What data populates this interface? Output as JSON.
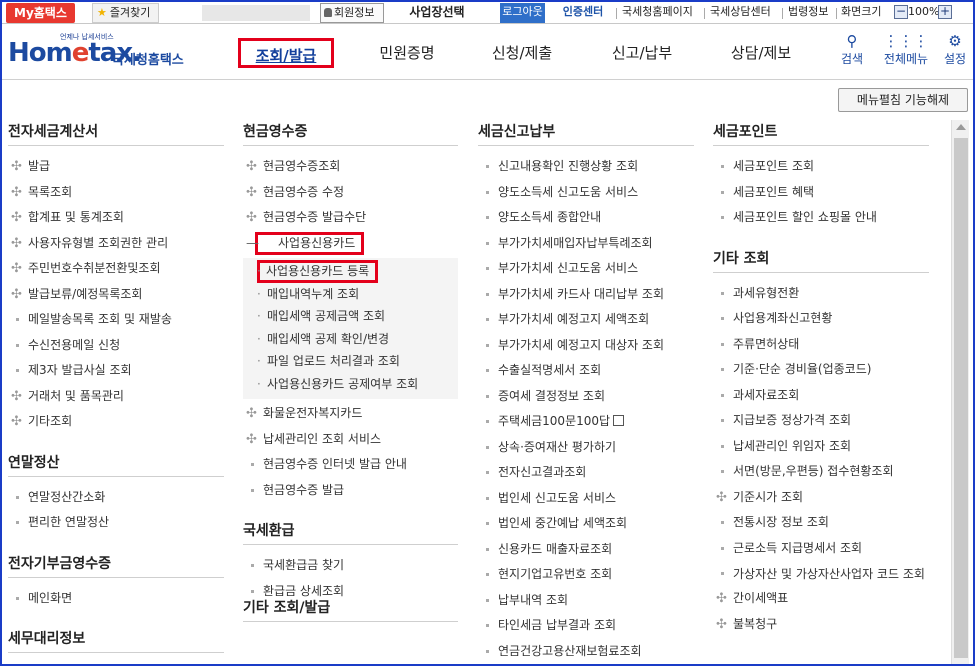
{
  "topbar": {
    "my_hometax": "My홈택스",
    "favorites": "즐겨찾기",
    "member_info": "회원정보",
    "select_business": "사업장선택",
    "logout": "로그아웃",
    "cert_center": "인증센터",
    "links": [
      "국세청홈페이지",
      "국세상담센터",
      "법령정보",
      "화면크기"
    ],
    "zoom_minus": "−",
    "zoom_value": "100%",
    "zoom_plus": "+"
  },
  "header": {
    "logo_small": "언제나 납세서비스",
    "logo_main_1": "Hom",
    "logo_main_2": "e",
    "logo_main_3": "tax.",
    "logo_kr": "국세청홈택스",
    "nav": [
      "조회/발급",
      "민원증명",
      "신청/제출",
      "신고/납부",
      "상담/제보"
    ],
    "icons": [
      {
        "label": "검색",
        "icon": "search-icon"
      },
      {
        "label": "전체메뉴",
        "icon": "grid-icon"
      },
      {
        "label": "설정",
        "icon": "gear-icon"
      }
    ]
  },
  "unfold_button": "메뉴펼침 기능해제",
  "col1": {
    "s1_title": "전자세금계산서",
    "s1_items": [
      "발급",
      "목록조회",
      "합계표 및 통계조회",
      "사용자유형별 조회권한 관리",
      "주민번호수취분전환및조회",
      "발급보류/예정목록조회",
      "메일발송목록 조회 및 재발송",
      "수신전용메일 신청",
      "제3자 발급사실 조회",
      "거래처 및 품목관리",
      "기타조회"
    ],
    "s2_title": "연말정산",
    "s2_items": [
      "연말정산간소화",
      "편리한 연말정산"
    ],
    "s3_title": "전자기부금영수증",
    "s3_items": [
      "메인화면"
    ],
    "s4_title": "세무대리정보"
  },
  "col2": {
    "s1_title": "현금영수증",
    "s1_items": [
      "현금영수증조회",
      "현금영수증 수정",
      "현금영수증 발급수단"
    ],
    "open_item": "사업용신용카드",
    "sub_items": [
      "사업용신용카드 등록",
      "매입내역누계 조회",
      "매입세액 공제금액 조회",
      "매입세액 공제 확인/변경",
      "파일 업로드 처리결과 조회",
      "사업용신용카드 공제여부 조회"
    ],
    "s1_items_after": [
      "화물운전자복지카드",
      "납세관리인 조회 서비스",
      "현금영수증 인터넷 발급 안내",
      "현금영수증 발급"
    ],
    "s2_title": "국세환급",
    "s2_items": [
      "국세환급금 찾기",
      "환급금 상세조회"
    ],
    "s3_title": "기타 조회/발급"
  },
  "col3": {
    "s1_title": "세금신고납부",
    "s1_items": [
      "신고내용확인 진행상황 조회",
      "양도소득세 신고도움 서비스",
      "양도소득세 종합안내",
      "부가가치세매입자납부특례조회",
      "부가가치세 신고도움 서비스",
      "부가가치세 카드사 대리납부 조회",
      "부가가치세 예정고지 세액조회",
      "부가가치세 예정고지 대상자 조회",
      "수출실적명세서 조회",
      "증여세 결정정보 조회",
      "주택세금100문100답",
      "상속·증여재산 평가하기",
      "전자신고결과조회",
      "법인세 신고도움 서비스",
      "법인세 중간예납 세액조회",
      "신용카드 매출자료조회",
      "현지기업고유번호 조회",
      "납부내역 조회",
      "타인세금 납부결과 조회",
      "연금건강고용산재보험료조회"
    ]
  },
  "col4": {
    "s1_title": "세금포인트",
    "s1_items": [
      "세금포인트 조회",
      "세금포인트 혜택",
      "세금포인트 할인 쇼핑몰 안내"
    ],
    "s2_title": "기타 조회",
    "s2_items": [
      "과세유형전환",
      "사업용계좌신고현황",
      "주류면허상태",
      "기준·단순 경비율(업종코드)",
      "과세자료조회",
      "지급보증 정상가격 조회",
      "납세관리인 위임자 조회",
      "서면(방문,우편등) 접수현황조회",
      "기준시가 조회",
      "전통시장 정보 조회",
      "근로소득 지급명세서 조회",
      "가상자산 및 가상자산사업자 코드 조회",
      "간이세액표",
      "불복청구"
    ]
  }
}
